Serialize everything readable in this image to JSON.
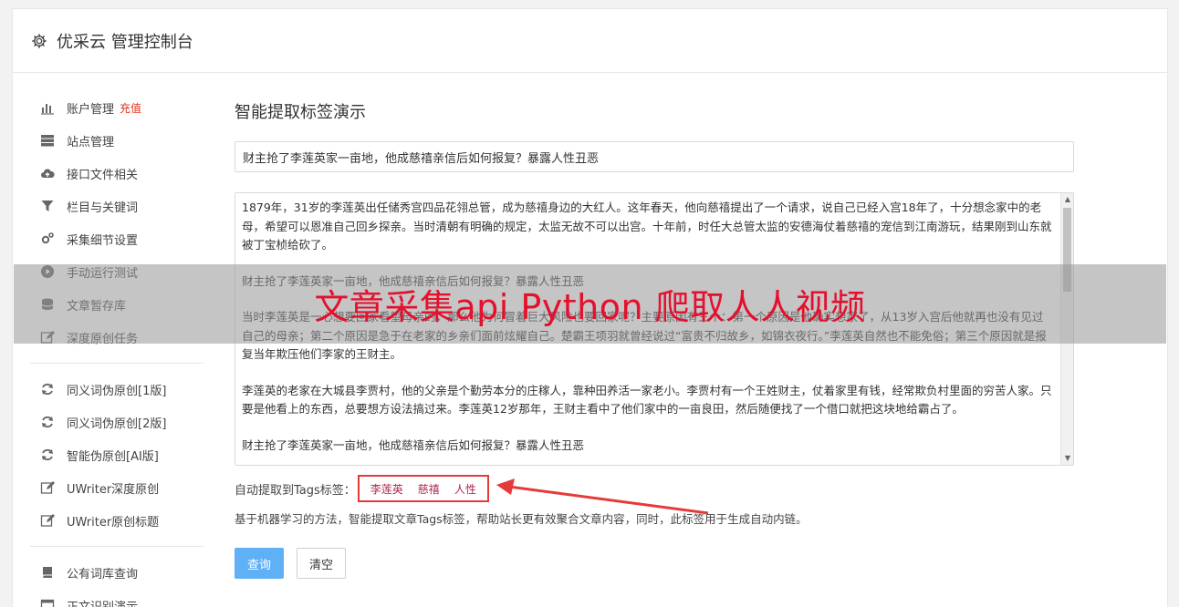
{
  "header": {
    "title": "优采云 管理控制台"
  },
  "sidebar": {
    "group1": [
      {
        "icon": "bar-chart-icon",
        "label": "账户管理",
        "badge": "充值"
      },
      {
        "icon": "server-icon",
        "label": "站点管理"
      },
      {
        "icon": "cloud-upload-icon",
        "label": "接口文件相关"
      },
      {
        "icon": "filter-icon",
        "label": "栏目与关键词"
      },
      {
        "icon": "gears-icon",
        "label": "采集细节设置"
      },
      {
        "icon": "play-circle-icon",
        "label": "手动运行测试"
      },
      {
        "icon": "database-icon",
        "label": "文章暂存库"
      },
      {
        "icon": "edit-icon",
        "label": "深度原创任务"
      }
    ],
    "group2": [
      {
        "icon": "refresh-icon",
        "label": "同义词伪原创[1版]"
      },
      {
        "icon": "refresh-icon",
        "label": "同义词伪原创[2版]"
      },
      {
        "icon": "refresh-icon",
        "label": "智能伪原创[AI版]"
      },
      {
        "icon": "edit-icon",
        "label": "UWriter深度原创"
      },
      {
        "icon": "edit-icon",
        "label": "UWriter原创标题"
      }
    ],
    "group3": [
      {
        "icon": "book-icon",
        "label": "公有词库查询"
      },
      {
        "icon": "window-icon",
        "label": "正文识别演示"
      }
    ]
  },
  "main": {
    "page_title": "智能提取标签演示",
    "title_value": "财主抢了李莲英家一亩地，他成慈禧亲信后如何报复？暴露人性丑恶",
    "content_paragraphs": [
      "1879年，31岁的李莲英出任储秀宫四品花翎总管，成为慈禧身边的大红人。这年春天，他向慈禧提出了一个请求，说自己已经入宫18年了，十分想念家中的老母，希望可以恩准自己回乡探亲。当时清朝有明确的规定，太监无故不可以出宫。十年前，时任大总管太监的安德海仗着慈禧的宠信到江南游玩，结果刚到山东就被丁宝桢给砍了。",
      "财主抢了李莲英家一亩地，他成慈禧亲信后如何报复？暴露人性丑恶",
      "当时李莲英是一心想要回家看望母亲的，那么他为何冒着巨大风险也要回家呢？主要原因有三个：第一个原因是他确实想家了，从13岁入宫后他就再也没有见过自己的母亲；第二个原因是急于在老家的乡亲们面前炫耀自己。楚霸王项羽就曾经说过“富贵不归故乡，如锦衣夜行。”李莲英自然也不能免俗；第三个原因就是报复当年欺压他们李家的王财主。",
      "李莲英的老家在大城县李贾村，他的父亲是个勤劳本分的庄稼人，靠种田养活一家老小。李贾村有一个王姓财主，仗着家里有钱，经常欺负村里面的穷苦人家。只要是他看上的东西，总要想方设法搞过来。李莲英12岁那年，王财主看中了他们家中的一亩良田，然后随便找了一个借口就把这块地给霸占了。",
      "财主抢了李莲英家一亩地，他成慈禧亲信后如何报复？暴露人性丑恶"
    ],
    "tags_label": "自动提取到Tags标签：",
    "tags": [
      "李莲英",
      "慈禧",
      "人性"
    ],
    "description": "基于机器学习的方法，智能提取文章Tags标签，帮助站长更有效聚合文章内容，同时，此标签用于生成自动内链。",
    "query_button": "查询",
    "clear_button": "清空"
  },
  "overlay": {
    "text": "文章采集api Python 爬取人人视频"
  },
  "colors": {
    "accent": "#5fb0f5",
    "badge": "#e0321e",
    "highlight_red": "#e53a3a",
    "overlay_text": "#e4102d"
  }
}
